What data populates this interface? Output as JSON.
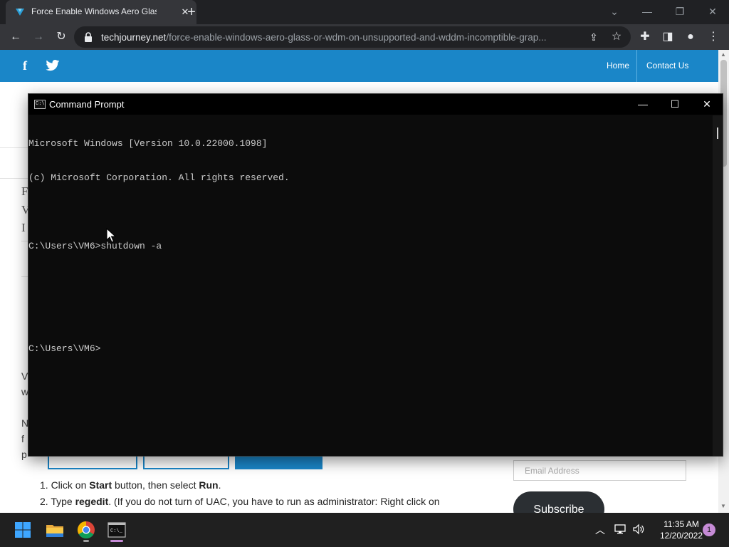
{
  "browser": {
    "tab_title": "Force Enable Windows Aero Glass",
    "tab_close": "✕",
    "new_tab": "+",
    "url_host": "techjourney.net",
    "url_path": "/force-enable-windows-aero-glass-or-wdm-on-unsupported-and-wddm-incomptible-grap..."
  },
  "site": {
    "facebook_label": "f",
    "nav_home": "Home",
    "nav_contact": "Contact Us",
    "step_1_num": "1. Click on ",
    "step_1_bold": "Start",
    "step_1_mid": " button, then select ",
    "step_1_bold2": "Run",
    "step_1_end": ".",
    "step_2_num": "2. Type ",
    "step_2_bold": "regedit",
    "step_2_end": ". (If you do not turn of UAC, you have to run as administrator: Right click on",
    "email_placeholder": "Email Address",
    "subscribe_label": "Subscribe"
  },
  "cmd": {
    "window_title": "Command Prompt",
    "lines": [
      "Microsoft Windows [Version 10.0.22000.1098]",
      "(c) Microsoft Corporation. All rights reserved.",
      "",
      "C:\\Users\\VM6>shutdown -a",
      "",
      "",
      "C:\\Users\\VM6>"
    ]
  },
  "taskbar": {
    "time": "11:35 AM",
    "date": "12/20/2022",
    "notification_count": "1"
  },
  "colors": {
    "site_header": "#1a86c8",
    "browser_chrome": "#35363a",
    "cmd_background": "#0c0c0c",
    "taskbar": "#202020"
  }
}
